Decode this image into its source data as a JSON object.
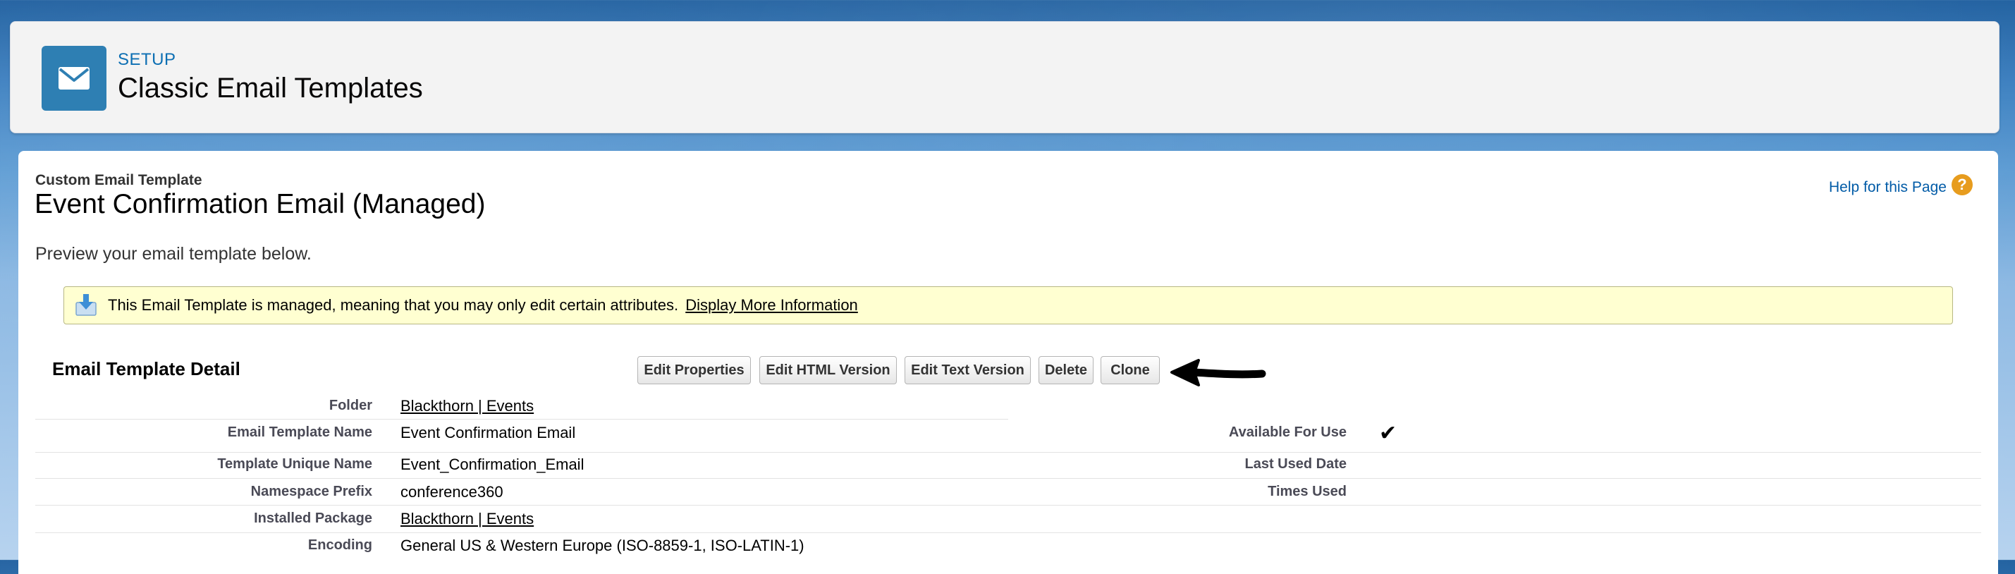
{
  "header": {
    "setup_label": "SETUP",
    "title": "Classic Email Templates",
    "icon": "envelope-icon",
    "icon_color": "#2e7fb3"
  },
  "page": {
    "subtitle": "Custom Email Template",
    "title": "Event Confirmation Email (Managed)",
    "help_link": "Help for this Page",
    "help_icon": "question-icon",
    "preview_text": "Preview your email template below."
  },
  "info": {
    "icon": "download-icon",
    "text": "This Email Template is managed, meaning that you may only edit certain attributes.",
    "link": "Display More Information"
  },
  "detail": {
    "section_title": "Email Template Detail",
    "buttons": {
      "edit_properties": "Edit Properties",
      "edit_html": "Edit HTML Version",
      "edit_text": "Edit Text Version",
      "delete": "Delete",
      "clone": "Clone"
    },
    "fields": {
      "folder_label": "Folder",
      "folder_value": "Blackthorn | Events",
      "name_label": "Email Template Name",
      "name_value": "Event Confirmation Email",
      "available_label": "Available For Use",
      "available_value": "✔",
      "unique_label": "Template Unique Name",
      "unique_value": "Event_Confirmation_Email",
      "last_used_label": "Last Used Date",
      "last_used_value": "",
      "namespace_label": "Namespace Prefix",
      "namespace_value": "conference360",
      "times_used_label": "Times Used",
      "times_used_value": "",
      "package_label": "Installed Package",
      "package_value": "Blackthorn | Events",
      "encoding_label": "Encoding",
      "encoding_value": "General US & Western Europe (ISO-8859-1, ISO-LATIN-1)"
    }
  },
  "colors": {
    "info_bg": "#ffffd1",
    "link": "#015ba7",
    "help_icon": "#e79c1e"
  }
}
